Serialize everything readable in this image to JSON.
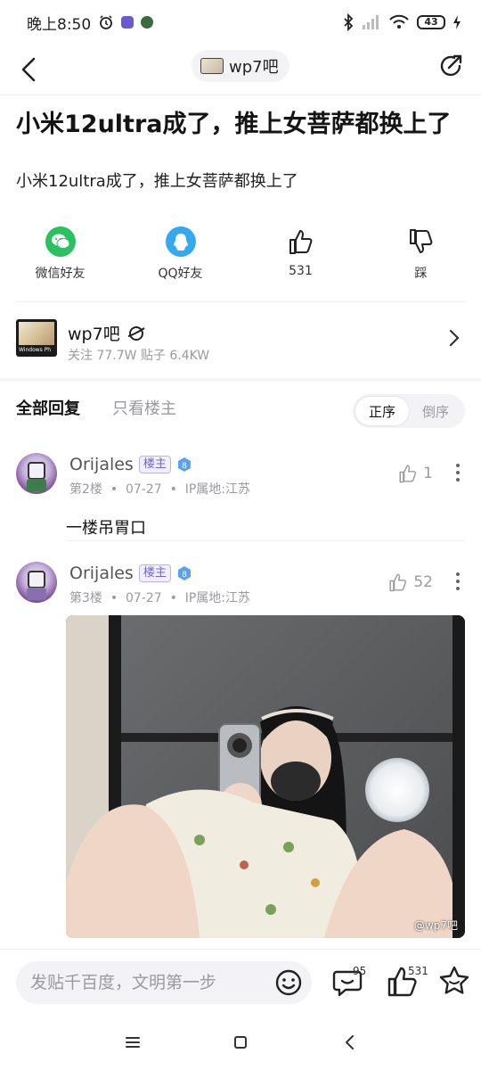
{
  "status_bar": {
    "time": "晚上8:50",
    "battery": "43"
  },
  "nav": {
    "forum_name": "wp7吧"
  },
  "post": {
    "title": "小米12ultra成了，推上女菩萨都换上了",
    "body": "小米12ultra成了，推上女菩萨都换上了"
  },
  "actions": [
    {
      "label": "微信好友",
      "icon": "wechat-icon"
    },
    {
      "label": "QQ好友",
      "icon": "qq-icon"
    },
    {
      "label": "531",
      "icon": "thumbs-up-icon"
    },
    {
      "label": "踩",
      "icon": "thumbs-down-icon"
    }
  ],
  "forum_card": {
    "name": "wp7吧",
    "thumb_text": "Windows Ph",
    "stats": "关注 77.7W  贴子 6.4KW"
  },
  "tabs": {
    "all": "全部回复",
    "op_only": "只看楼主"
  },
  "sort": {
    "asc": "正序",
    "desc": "倒序"
  },
  "replies": [
    {
      "user": "Orijales",
      "badge": "楼主",
      "level": "8",
      "floor": "第2楼",
      "date": "07-27",
      "ip": "IP属地:江苏",
      "likes": "1",
      "text": "一楼吊胃口"
    },
    {
      "user": "Orijales",
      "badge": "楼主",
      "level": "8",
      "floor": "第3楼",
      "date": "07-27",
      "ip": "IP属地:江苏",
      "likes": "52",
      "text": ""
    }
  ],
  "photo": {
    "watermark": "@wp7吧"
  },
  "bottom": {
    "placeholder": "发贴千百度，文明第一步",
    "comment_count": "95",
    "like_count": "531"
  },
  "colors": {
    "wechat": "#2cc160",
    "qq": "#35a9f0",
    "op_badge": "#6f63e6",
    "level_badge": "#5aa0f5"
  }
}
